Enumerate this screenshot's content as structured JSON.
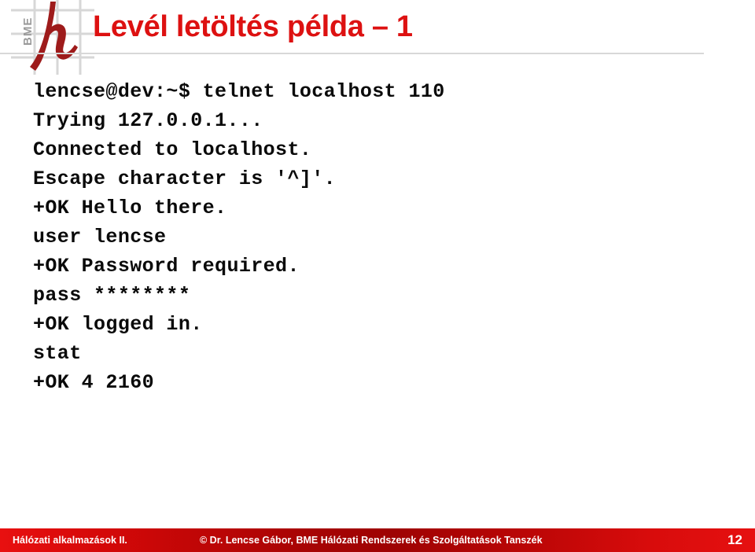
{
  "header": {
    "title": "Levél letöltés példa – 1",
    "title_color": "#dd1111",
    "logo": {
      "wordmark": "BME",
      "glyph": "h",
      "glyph_color": "#9e1b1b",
      "grid_color": "#d5d5d5",
      "wordmark_color": "#999999"
    }
  },
  "terminal": {
    "lines": [
      "lencse@dev:~$ telnet localhost 110",
      "Trying 127.0.0.1...",
      "Connected to localhost.",
      "Escape character is '^]'.",
      "+OK Hello there.",
      "user lencse",
      "+OK Password required.",
      "pass ********",
      "+OK logged in.",
      "stat",
      "+OK 4 2160"
    ]
  },
  "footer": {
    "left": "Hálózati alkalmazások II.",
    "center": "©  Dr. Lencse Gábor, BME Hálózati Rendszerek és Szolgáltatások Tanszék",
    "page_number": "12",
    "band_color": "#c00707"
  }
}
